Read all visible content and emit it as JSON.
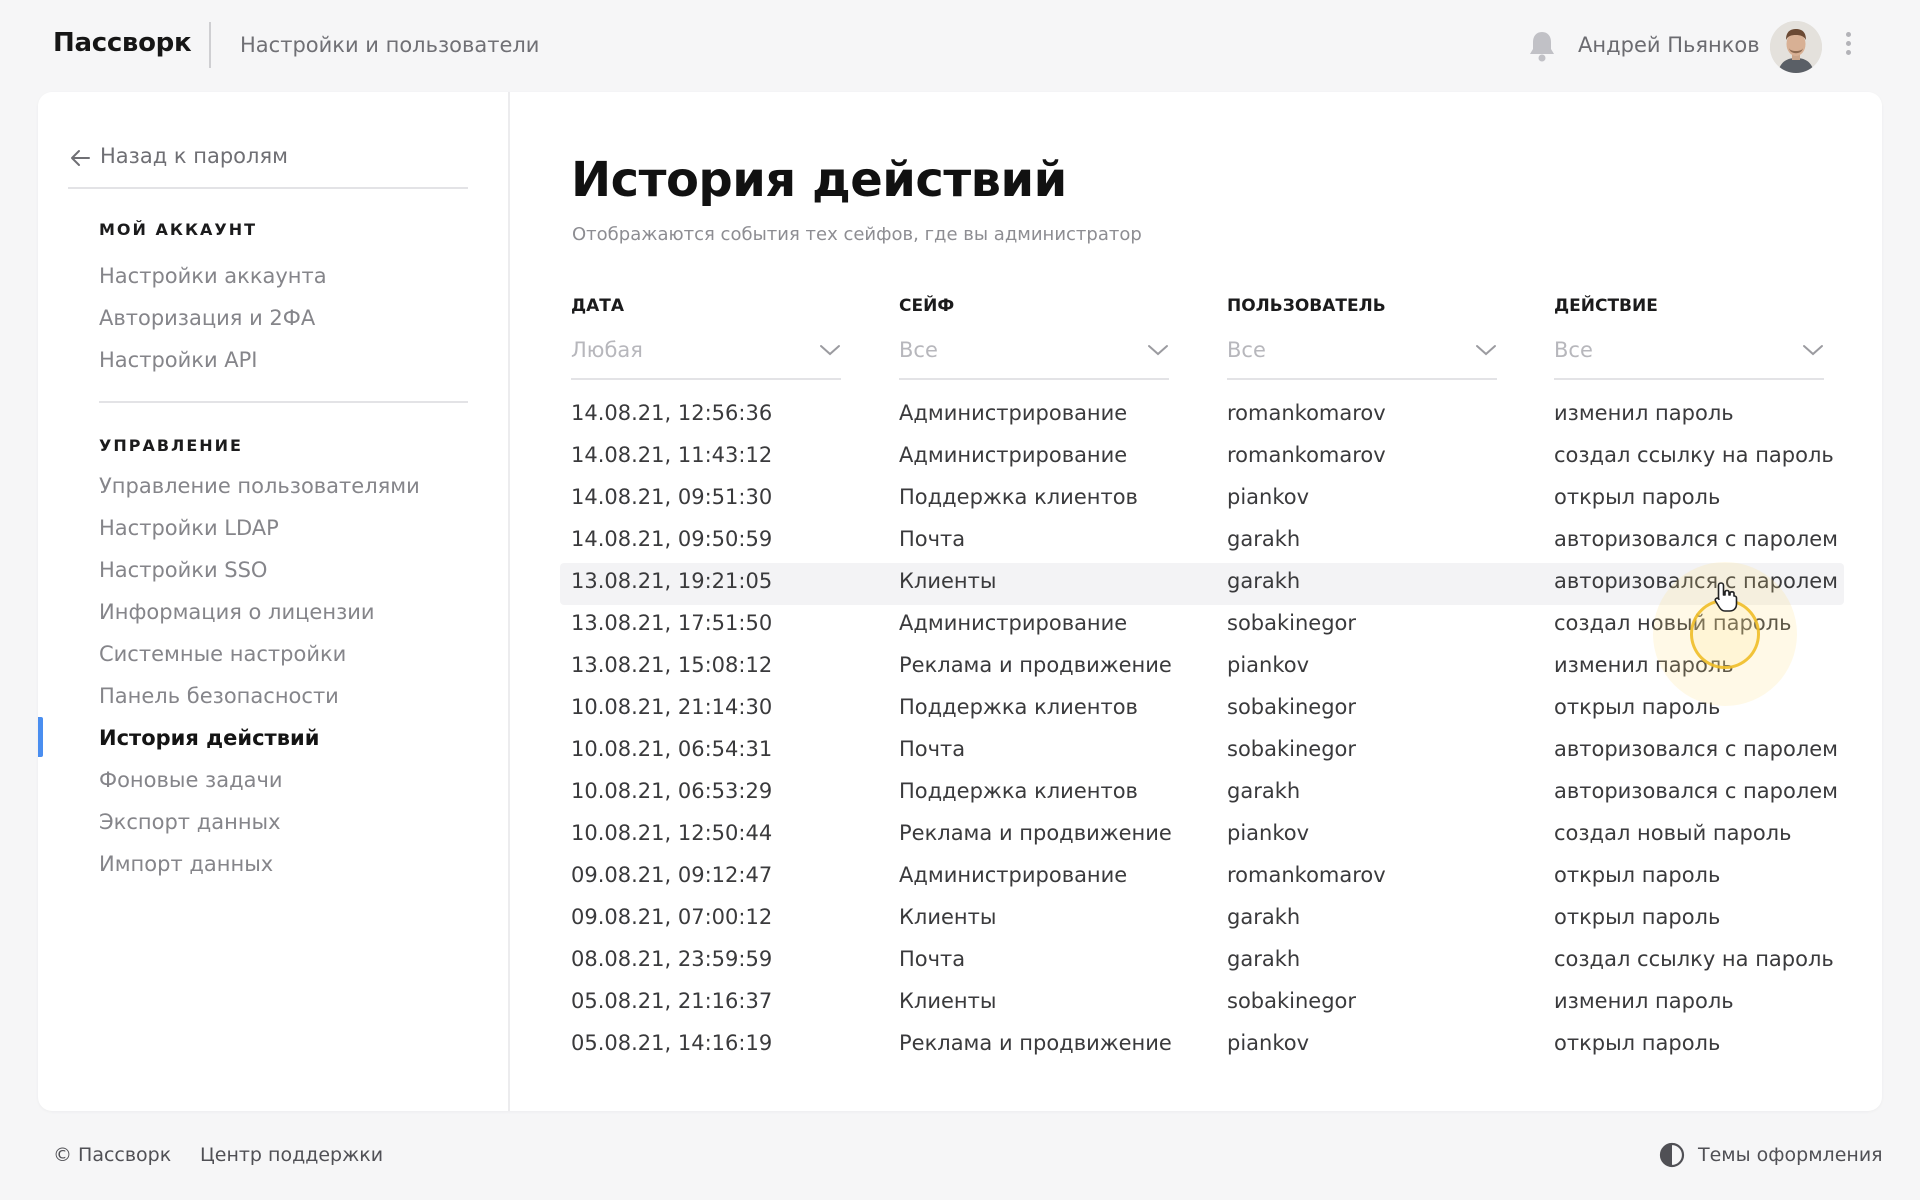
{
  "header": {
    "brand": "Пассворк",
    "section": "Настройки и пользователи",
    "user_name": "Андрей Пьянков",
    "icons": {
      "notifications": "bell-icon",
      "menu": "kebab-menu-icon"
    }
  },
  "sidebar": {
    "back_label": "Назад к паролям",
    "account_group": {
      "title": "МОЙ АККАУНТ",
      "items": [
        {
          "label": "Настройки аккаунта"
        },
        {
          "label": "Авторизация и 2ФА"
        },
        {
          "label": "Настройки API"
        }
      ]
    },
    "management_group": {
      "title": "УПРАВЛЕНИЕ",
      "items": [
        {
          "label": "Управление пользователями"
        },
        {
          "label": "Настройки LDAP"
        },
        {
          "label": "Настройки SSO"
        },
        {
          "label": "Информация о лицензии"
        },
        {
          "label": "Системные настройки"
        },
        {
          "label": "Панель безопасности"
        },
        {
          "label": "История действий",
          "active": true
        },
        {
          "label": "Фоновые задачи"
        },
        {
          "label": "Экспорт данных"
        },
        {
          "label": "Импорт данных"
        }
      ]
    },
    "accent_color": "#4a8ef0"
  },
  "main": {
    "title": "История действий",
    "subtitle": "Отображаются события тех сейфов, где вы администратор",
    "columns": [
      {
        "header": "ДАТА",
        "filter_value": "Любая"
      },
      {
        "header": "СЕЙФ",
        "filter_value": "Все"
      },
      {
        "header": "ПОЛЬЗОВАТЕЛЬ",
        "filter_value": "Все"
      },
      {
        "header": "ДЕЙСТВИЕ",
        "filter_value": "Все"
      }
    ],
    "rows": [
      [
        "14.08.21, 12:56:36",
        "Администрирование",
        "romankomarov",
        "изменил пароль"
      ],
      [
        "14.08.21, 11:43:12",
        "Администрирование",
        "romankomarov",
        "создал ссылку на пароль"
      ],
      [
        "14.08.21, 09:51:30",
        "Поддержка клиентов",
        "piankov",
        "открыл пароль"
      ],
      [
        "14.08.21, 09:50:59",
        "Почта",
        "garakh",
        "авторизовался с паролем"
      ],
      [
        "13.08.21, 19:21:05",
        "Клиенты",
        "garakh",
        "авторизовался с паролем"
      ],
      [
        "13.08.21, 17:51:50",
        "Администрирование",
        "sobakinegor",
        "создал новый пароль"
      ],
      [
        "13.08.21, 15:08:12",
        "Реклама и продвижение",
        "piankov",
        "изменил пароль"
      ],
      [
        "10.08.21, 21:14:30",
        "Поддержка клиентов",
        "sobakinegor",
        "открыл пароль"
      ],
      [
        "10.08.21, 06:54:31",
        "Почта",
        "sobakinegor",
        "авторизовался с паролем"
      ],
      [
        "10.08.21, 06:53:29",
        "Поддержка клиентов",
        "garakh",
        "авторизовался с паролем"
      ],
      [
        "10.08.21, 12:50:44",
        "Реклама и продвижение",
        "piankov",
        "создал новый пароль"
      ],
      [
        "09.08.21, 09:12:47",
        "Администрирование",
        "romankomarov",
        "открыл пароль"
      ],
      [
        "09.08.21, 07:00:12",
        "Клиенты",
        "garakh",
        "открыл пароль"
      ],
      [
        "08.08.21, 23:59:59",
        "Почта",
        "garakh",
        "создал ссылку на пароль"
      ],
      [
        "05.08.21, 21:16:37",
        "Клиенты",
        "sobakinegor",
        "изменил пароль"
      ],
      [
        "05.08.21, 14:16:19",
        "Реклама и продвижение",
        "piankov",
        "открыл пароль"
      ]
    ],
    "hovered_row": 4
  },
  "footer": {
    "copyright": "© Пассворк",
    "support": "Центр поддержки",
    "themes": "Темы оформления"
  }
}
